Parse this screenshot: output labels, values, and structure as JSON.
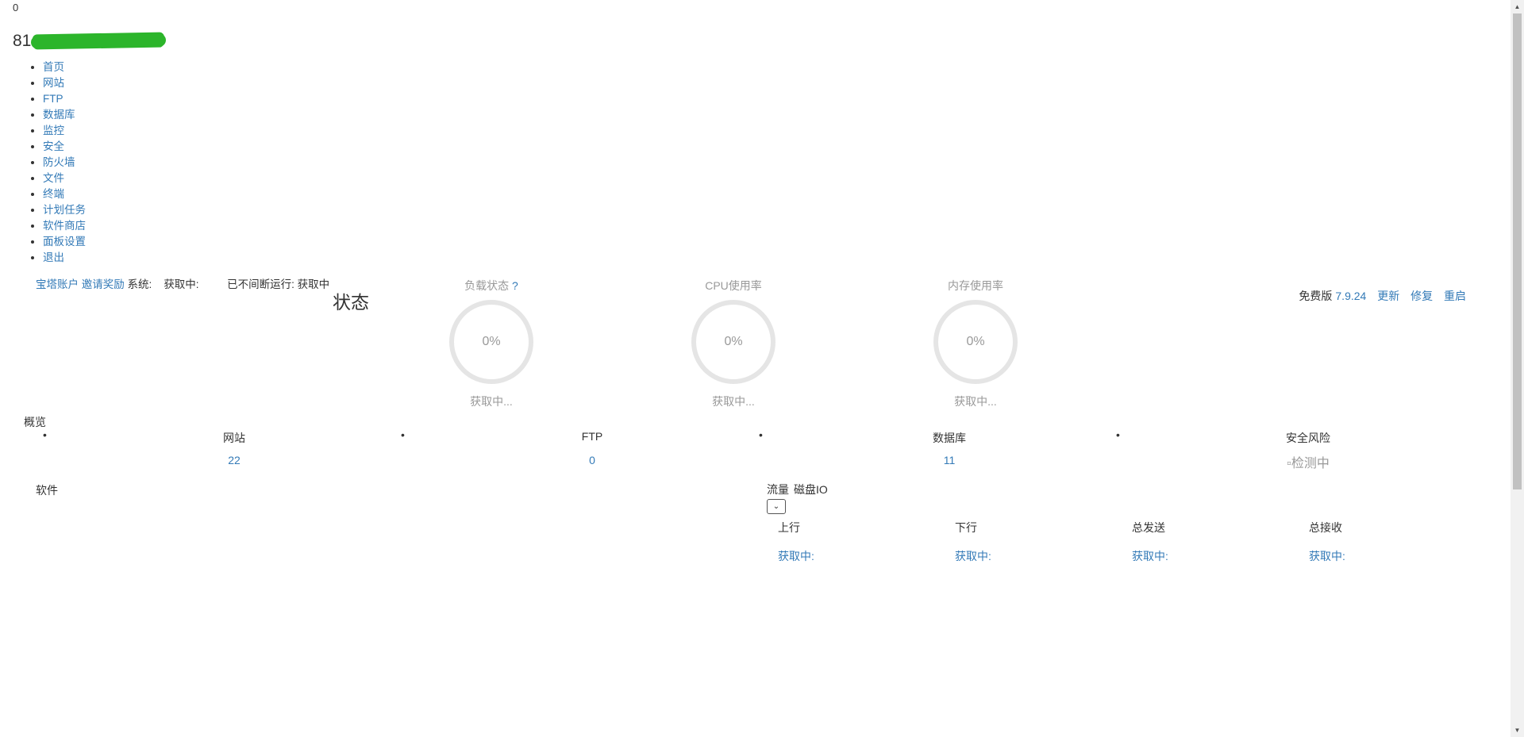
{
  "top_counter": "0",
  "brand": {
    "prefix": "81"
  },
  "nav": [
    "首页",
    "网站",
    "FTP",
    "数据库",
    "监控",
    "安全",
    "防火墙",
    "文件",
    "终端",
    "计划任务",
    "软件商店",
    "面板设置",
    "退出"
  ],
  "account": {
    "bt_account": "宝塔账户",
    "invite": "邀请奖励",
    "system_label": "系统:",
    "system_value": "获取中:",
    "uptime_label": "已不间断运行:",
    "uptime_value": "获取中"
  },
  "status_title": "状态",
  "gauges": [
    {
      "title": "负载状态",
      "help": "?",
      "value": "0%",
      "sub": "获取中..."
    },
    {
      "title": "CPU使用率",
      "help": "",
      "value": "0%",
      "sub": "获取中..."
    },
    {
      "title": "内存使用率",
      "help": "",
      "value": "0%",
      "sub": "获取中..."
    }
  ],
  "version": {
    "label": "免费版",
    "number": "7.9.24",
    "update": "更新",
    "repair": "修复",
    "restart": "重启"
  },
  "overview": {
    "title": "概览",
    "items": [
      {
        "label": "网站",
        "value": "22"
      },
      {
        "label": "FTP",
        "value": "0"
      },
      {
        "label": "数据库",
        "value": "11"
      },
      {
        "label": "安全风险",
        "value": "检测中"
      }
    ]
  },
  "software_title": "软件",
  "traffic": {
    "tabs": [
      "流量",
      "磁盘IO"
    ],
    "select_icon": "chevron-down-icon",
    "columns": [
      {
        "head": "上行",
        "value": "获取中:"
      },
      {
        "head": "下行",
        "value": "获取中:"
      },
      {
        "head": "总发送",
        "value": "获取中:"
      },
      {
        "head": "总接收",
        "value": "获取中:"
      }
    ]
  }
}
